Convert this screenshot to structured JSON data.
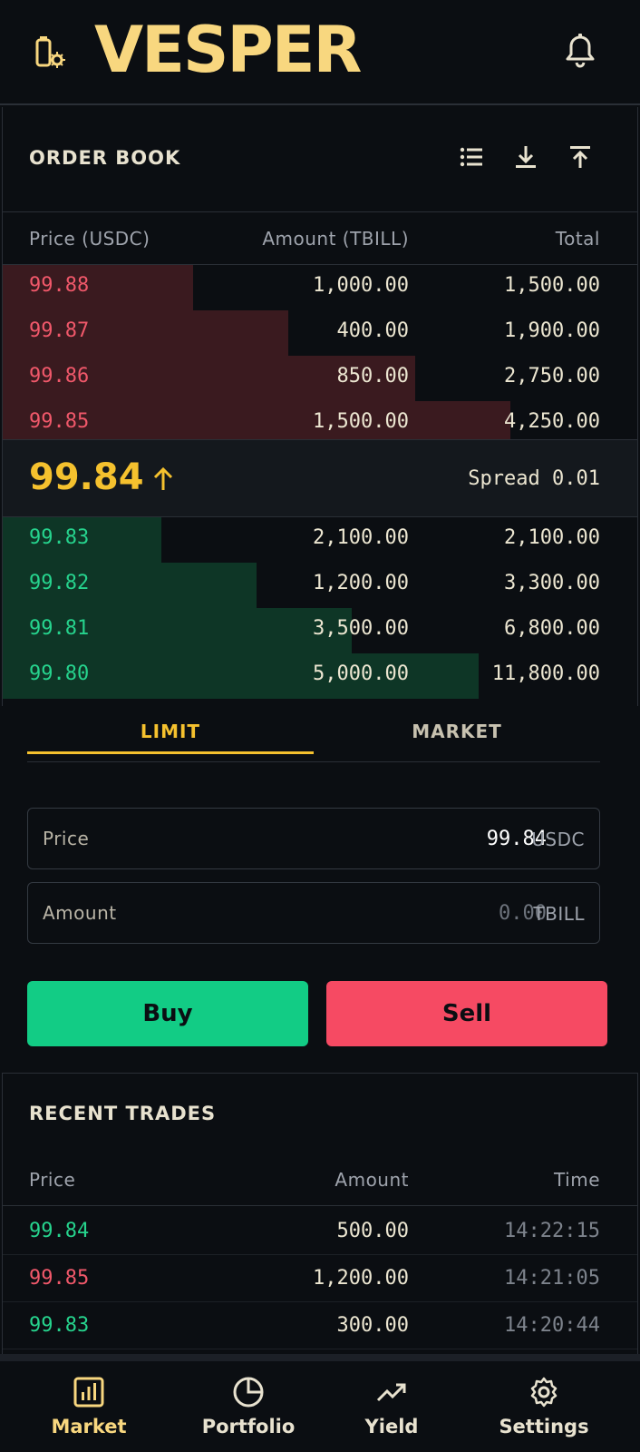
{
  "app": {
    "brand": "VESPER"
  },
  "order_book": {
    "title": "ORDER BOOK",
    "columns": {
      "price": "Price (USDC)",
      "amount": "Amount (TBILL)",
      "total": "Total"
    },
    "asks": [
      {
        "price": "99.88",
        "amount": "1,000.00",
        "total": "1,500.00",
        "depth": 0.3
      },
      {
        "price": "99.87",
        "amount": "400.00",
        "total": "1,900.00",
        "depth": 0.45
      },
      {
        "price": "99.86",
        "amount": "850.00",
        "total": "2,750.00",
        "depth": 0.65
      },
      {
        "price": "99.85",
        "amount": "1,500.00",
        "total": "4,250.00",
        "depth": 0.8
      }
    ],
    "last_price": "99.84",
    "last_direction": "up",
    "spread_label": "Spread 0.01",
    "bids": [
      {
        "price": "99.83",
        "amount": "2,100.00",
        "total": "2,100.00",
        "depth": 0.25
      },
      {
        "price": "99.82",
        "amount": "1,200.00",
        "total": "3,300.00",
        "depth": 0.4
      },
      {
        "price": "99.81",
        "amount": "3,500.00",
        "total": "6,800.00",
        "depth": 0.55
      },
      {
        "price": "99.80",
        "amount": "5,000.00",
        "total": "11,800.00",
        "depth": 0.75
      }
    ]
  },
  "order_form": {
    "tabs": [
      {
        "label": "LIMIT",
        "active": true
      },
      {
        "label": "MARKET",
        "active": false
      }
    ],
    "price_field": {
      "label": "Price",
      "value": "99.84",
      "unit": "USDC"
    },
    "amount_field": {
      "label": "Amount",
      "placeholder": "0.00",
      "unit": "TBILL"
    },
    "buy_label": "Buy",
    "sell_label": "Sell"
  },
  "recent_trades": {
    "title": "RECENT TRADES",
    "columns": {
      "price": "Price",
      "amount": "Amount",
      "time": "Time"
    },
    "rows": [
      {
        "price": "99.84",
        "amount": "500.00",
        "time": "14:22:15",
        "side": "up"
      },
      {
        "price": "99.85",
        "amount": "1,200.00",
        "time": "14:21:05",
        "side": "down"
      },
      {
        "price": "99.83",
        "amount": "300.00",
        "time": "14:20:44",
        "side": "up"
      }
    ]
  },
  "nav": {
    "items": [
      {
        "label": "Market",
        "icon": "bar-chart-icon",
        "active": true
      },
      {
        "label": "Portfolio",
        "icon": "pie-chart-icon",
        "active": false
      },
      {
        "label": "Yield",
        "icon": "trending-up-icon",
        "active": false
      },
      {
        "label": "Settings",
        "icon": "gear-icon",
        "active": false
      }
    ]
  },
  "colors": {
    "accent": "#f5c12e",
    "brand": "#f8d77f",
    "buy": "#12cc85",
    "sell": "#f64a63",
    "ask_depth": "#3a1a1f",
    "bid_depth": "#0e3626",
    "background": "#0b0e12"
  }
}
